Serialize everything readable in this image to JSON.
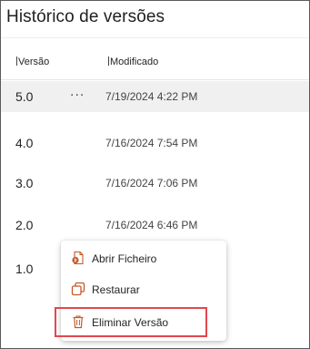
{
  "panel": {
    "title": "Histórico de versões"
  },
  "columns": {
    "version": "Versão",
    "modified": "Modificado"
  },
  "rows": [
    {
      "version": "5.0",
      "modified": "7/19/2024 4:22 PM",
      "more": "..."
    },
    {
      "version": "4.0",
      "modified": "7/16/2024 7:54 PM"
    },
    {
      "version": "3.0",
      "modified": "7/16/2024 7:06 PM"
    },
    {
      "version": "2.0",
      "modified": "7/16/2024 6:46 PM"
    },
    {
      "version": "1.0",
      "modified": ""
    }
  ],
  "context_menu": {
    "items": [
      {
        "label": "Abrir Ficheiro",
        "icon": "word-file-icon"
      },
      {
        "label": "Restaurar",
        "icon": "restore-icon"
      },
      {
        "label": "Eliminar Versão",
        "icon": "trash-icon"
      }
    ],
    "highlighted_item": "Eliminar Versão"
  },
  "colors": {
    "selected_row": "#f0f0f0",
    "highlight_border": "#e2474f",
    "word_accent": "#c4592b"
  }
}
